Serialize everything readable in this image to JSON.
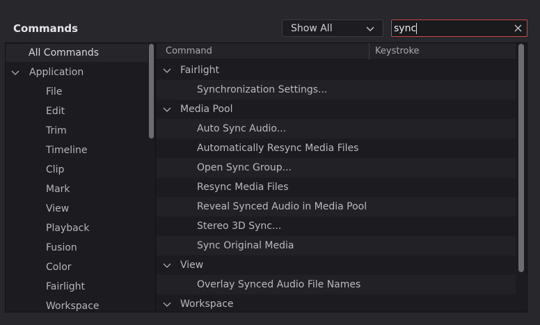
{
  "title": "Commands",
  "filter": {
    "selected": "Show All"
  },
  "search": {
    "value": "sync"
  },
  "categories": [
    {
      "label": "All Commands",
      "selected": true
    },
    {
      "label": "Application",
      "expanded": true
    },
    {
      "label": "File"
    },
    {
      "label": "Edit"
    },
    {
      "label": "Trim"
    },
    {
      "label": "Timeline"
    },
    {
      "label": "Clip"
    },
    {
      "label": "Mark"
    },
    {
      "label": "View"
    },
    {
      "label": "Playback"
    },
    {
      "label": "Fusion"
    },
    {
      "label": "Color"
    },
    {
      "label": "Fairlight"
    },
    {
      "label": "Workspace"
    }
  ],
  "table": {
    "columns": {
      "command": "Command",
      "keystroke": "Keystroke"
    },
    "rows": [
      {
        "kind": "group",
        "label": "Fairlight"
      },
      {
        "kind": "item",
        "label": "Synchronization Settings..."
      },
      {
        "kind": "group",
        "label": "Media Pool"
      },
      {
        "kind": "item",
        "label": "Auto Sync Audio..."
      },
      {
        "kind": "item",
        "label": "Automatically Resync Media Files"
      },
      {
        "kind": "item",
        "label": "Open Sync Group..."
      },
      {
        "kind": "item",
        "label": "Resync Media Files"
      },
      {
        "kind": "item",
        "label": "Reveal Synced Audio in Media Pool"
      },
      {
        "kind": "item",
        "label": "Stereo 3D Sync..."
      },
      {
        "kind": "item",
        "label": "Sync Original Media"
      },
      {
        "kind": "group",
        "label": "View"
      },
      {
        "kind": "item",
        "label": "Overlay Synced Audio File Names"
      },
      {
        "kind": "group",
        "label": "Workspace"
      }
    ]
  },
  "colors": {
    "background": "#27272c",
    "panel": "#1c1c20",
    "search_border": "#c44a4a"
  }
}
